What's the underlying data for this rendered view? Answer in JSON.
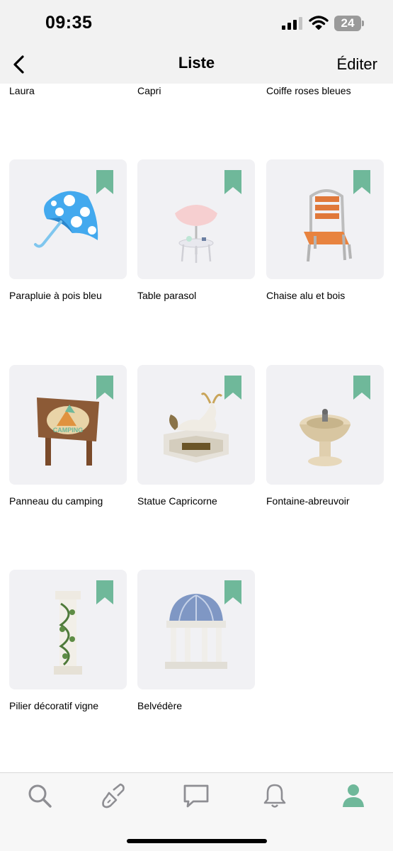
{
  "status": {
    "time": "09:35",
    "battery": "24"
  },
  "nav": {
    "title": "Liste",
    "edit_label": "Éditer"
  },
  "top_row": [
    "Laura",
    "Capri",
    "Coiffe roses bleues"
  ],
  "items": [
    {
      "label": "Parapluie à pois bleu",
      "icon": "polka-dot-umbrella-icon"
    },
    {
      "label": "Table parasol",
      "icon": "parasol-table-icon"
    },
    {
      "label": "Chaise alu et bois",
      "icon": "aluminum-wood-chair-icon"
    },
    {
      "label": "Panneau du camping",
      "icon": "camping-sign-icon",
      "sign_text": "CAMPING"
    },
    {
      "label": "Statue Capricorne",
      "icon": "capricorn-statue-icon"
    },
    {
      "label": "Fontaine-abreuvoir",
      "icon": "drinking-fountain-icon"
    },
    {
      "label": "Pilier décoratif vigne",
      "icon": "vine-pillar-icon"
    },
    {
      "label": "Belvédère",
      "icon": "gazebo-icon"
    }
  ],
  "tabs": [
    "search-icon",
    "paintbrush-icon",
    "chat-icon",
    "bell-icon",
    "profile-icon"
  ],
  "colors": {
    "accent": "#6fb89a",
    "card_bg": "#f1f1f4",
    "bar_bg": "#f2f2f2"
  }
}
